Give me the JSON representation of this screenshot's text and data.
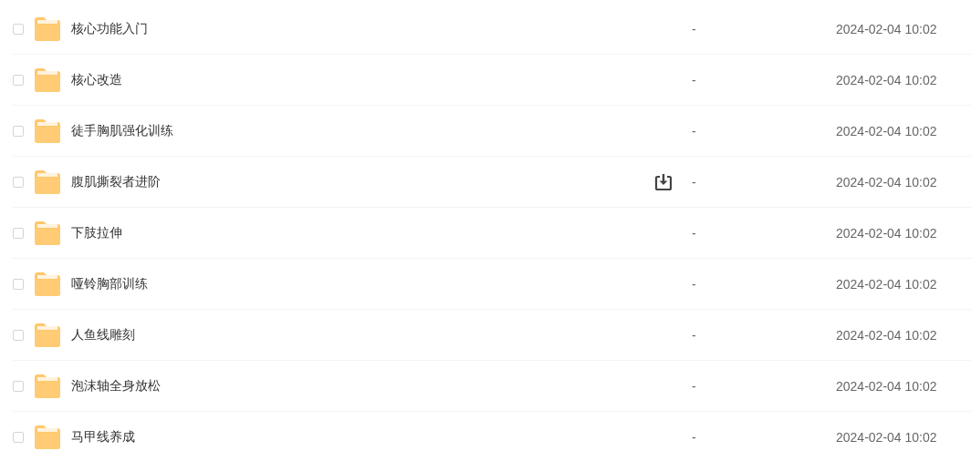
{
  "files": [
    {
      "name": "核心功能入门",
      "size": "-",
      "modified": "2024-02-04 10:02",
      "checked": false,
      "hovered": false
    },
    {
      "name": "核心改造",
      "size": "-",
      "modified": "2024-02-04 10:02",
      "checked": false,
      "hovered": false
    },
    {
      "name": "徒手胸肌强化训练",
      "size": "-",
      "modified": "2024-02-04 10:02",
      "checked": false,
      "hovered": false
    },
    {
      "name": "腹肌撕裂者进阶",
      "size": "-",
      "modified": "2024-02-04 10:02",
      "checked": false,
      "hovered": true
    },
    {
      "name": "下肢拉伸",
      "size": "-",
      "modified": "2024-02-04 10:02",
      "checked": false,
      "hovered": false
    },
    {
      "name": "哑铃胸部训练",
      "size": "-",
      "modified": "2024-02-04 10:02",
      "checked": false,
      "hovered": false
    },
    {
      "name": "人鱼线雕刻",
      "size": "-",
      "modified": "2024-02-04 10:02",
      "checked": false,
      "hovered": false
    },
    {
      "name": "泡沫轴全身放松",
      "size": "-",
      "modified": "2024-02-04 10:02",
      "checked": false,
      "hovered": false
    },
    {
      "name": "马甲线养成",
      "size": "-",
      "modified": "2024-02-04 10:02",
      "checked": false,
      "hovered": false
    }
  ]
}
